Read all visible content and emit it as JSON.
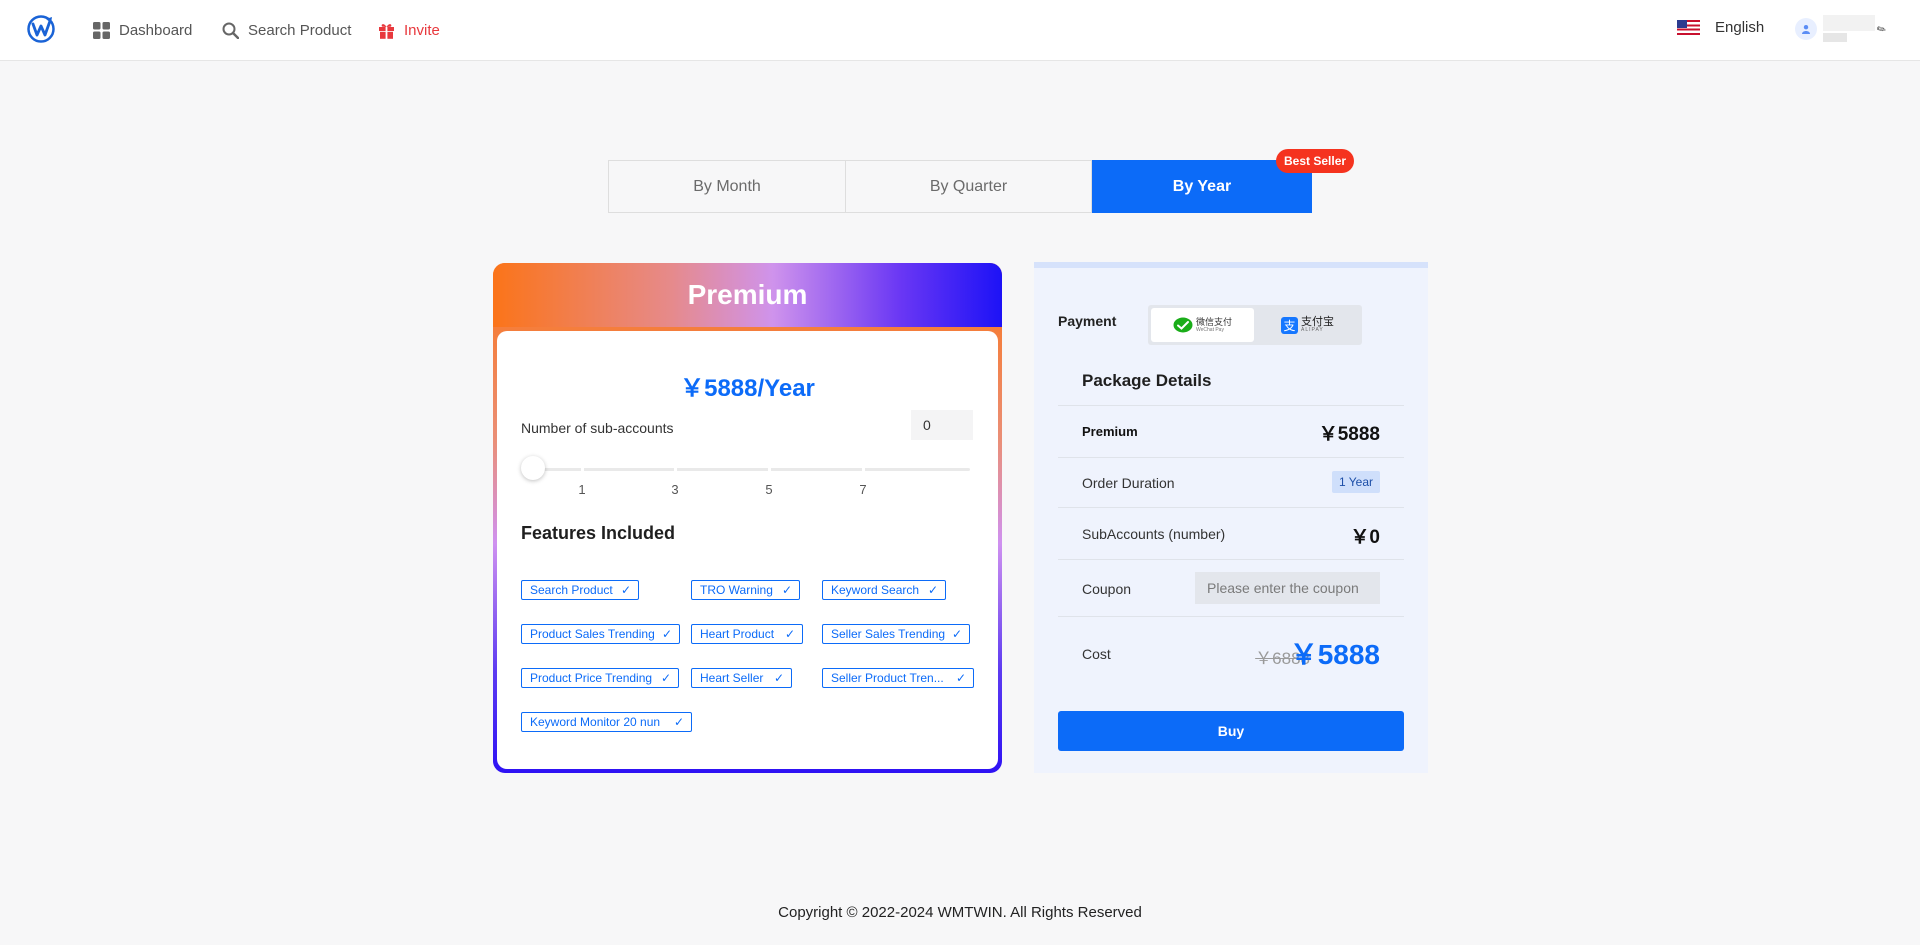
{
  "header": {
    "nav": {
      "dashboard": "Dashboard",
      "search_product": "Search Product",
      "invite": "Invite"
    },
    "language": "English"
  },
  "tabs": {
    "month": "By Month",
    "quarter": "By Quarter",
    "year": "By Year",
    "selected": "By Year",
    "badge": "Best Seller"
  },
  "plan": {
    "name": "Premium",
    "price": "￥5888/Year",
    "subaccounts_label": "Number of sub-accounts",
    "subaccounts_value": "0",
    "slider_value": 0,
    "slider_marks": [
      "1",
      "3",
      "5",
      "7"
    ],
    "features_title": "Features Included",
    "features": [
      "Search Product",
      "TRO Warning",
      "Keyword Search",
      "Product Sales Trending",
      "Heart Product",
      "Seller Sales Trending",
      "Product Price Trending",
      "Heart Seller",
      "Seller Product Tren...",
      "Keyword Monitor 20 nun"
    ]
  },
  "payment": {
    "label": "Payment",
    "methods": {
      "wechat_cn": "微信支付",
      "wechat_en": "WeChat Pay",
      "alipay_cn": "支付宝",
      "alipay_en": "ALIPAY"
    },
    "package_title": "Package Details",
    "rows": {
      "premium_label": "Premium",
      "premium_value": "￥5888",
      "duration_label": "Order Duration",
      "duration_value": "1 Year",
      "subaccounts_label": "SubAccounts (number)",
      "subaccounts_value": "￥0",
      "coupon_label": "Coupon",
      "coupon_placeholder": "Please enter the coupon",
      "cost_label": "Cost",
      "cost_original": "￥6888",
      "cost_final": "￥5888"
    },
    "buy_label": "Buy"
  },
  "footer": "Copyright © 2022-2024 WMTWIN. All Rights Reserved",
  "colors": {
    "primary": "#0c6bf8",
    "invite": "#e8383d",
    "badge": "#f5331f"
  }
}
